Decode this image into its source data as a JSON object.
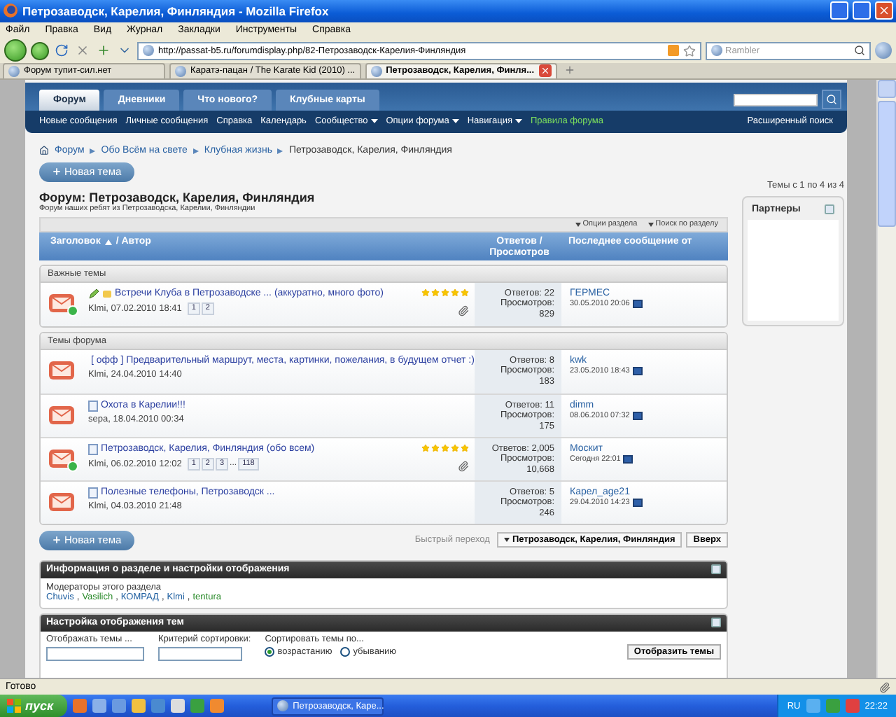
{
  "window": {
    "title": "Петрозаводск, Карелия, Финляндия - Mozilla Firefox"
  },
  "menu": [
    "Файл",
    "Правка",
    "Вид",
    "Журнал",
    "Закладки",
    "Инструменты",
    "Справка"
  ],
  "toolbar": {
    "url": "http://passat-b5.ru/forumdisplay.php/82-Петрозаводск-Карелия-Финляндия",
    "search_placeholder": "Rambler"
  },
  "tabs": [
    {
      "label": "Форум тупит-сил.нет",
      "selected": false
    },
    {
      "label": "Каратэ-пацан / The Karate Kid (2010) ...",
      "selected": false
    },
    {
      "label": "Петрозаводск, Карелия, Финля...",
      "selected": true
    }
  ],
  "forum_nav": {
    "tabs": [
      {
        "label": "Форум",
        "selected": true
      },
      {
        "label": "Дневники",
        "selected": false
      },
      {
        "label": "Что нового?",
        "selected": false
      },
      {
        "label": "Клубные карты",
        "selected": false
      }
    ],
    "links": [
      {
        "label": "Новые сообщения",
        "kind": "link"
      },
      {
        "label": "Личные сообщения",
        "kind": "link"
      },
      {
        "label": "Справка",
        "kind": "link"
      },
      {
        "label": "Календарь",
        "kind": "link"
      },
      {
        "label": "Сообщество",
        "kind": "dropdown"
      },
      {
        "label": "Опции форума",
        "kind": "dropdown"
      },
      {
        "label": "Навигация",
        "kind": "dropdown"
      },
      {
        "label": "Правила форума",
        "kind": "highlight"
      }
    ],
    "advanced_search": "Расширенный поиск"
  },
  "breadcrumb": [
    "Форум",
    "Обо Всём на свете",
    "Клубная жизнь",
    "Петрозаводск, Карелия, Финляндия"
  ],
  "new_topic_buttons": [
    "Новая тема",
    "Новая тема"
  ],
  "topic_count": "Темы с 1 по 4 из 4",
  "sidebar": {
    "title": "Партнеры"
  },
  "forum": {
    "title": "Форум: Петрозаводск, Карелия, Финляндия",
    "subtitle": "Форум наших ребят из Петрозаводска, Карелии, Финляндии"
  },
  "options": [
    "Опции раздела",
    "Поиск по разделу"
  ],
  "columns": {
    "title": "Заголовок",
    "author": "/ Автор",
    "stats": "Ответов / Просмотров",
    "last": "Последнее сообщение от"
  },
  "sections": [
    {
      "title": "Важные темы",
      "threads": [
        {
          "kind": "sticky",
          "badge": true,
          "title": "Встречи Клуба в Петрозаводске ... (аккуратно, много фото)",
          "author": "Klmi, 07.02.2010 18:41",
          "pages": [
            {
              "label": "1",
              "kind": "page"
            },
            {
              "label": "2",
              "kind": "page"
            }
          ],
          "stars": 5,
          "attachment": true,
          "replies": "Ответов: 22",
          "views_label": "Просмотров:",
          "views": "829",
          "last_user": "ГЕРМЕС",
          "last_date": "30.05.2010 20:06"
        }
      ]
    },
    {
      "title": "Темы форума",
      "threads": [
        {
          "kind": "normal",
          "badge": false,
          "title": "[ офф ] Предварительный маршрут, места, картинки, пожелания, в будущем отчет :)",
          "author": "Klmi, 24.04.2010 14:40",
          "attachment": false,
          "replies": "Ответов: 8",
          "views_label": "Просмотров:",
          "views": "183",
          "last_user": "kwk",
          "last_date": "23.05.2010 18:43"
        },
        {
          "kind": "normal",
          "badge": false,
          "title": "Охота в Карелии!!!",
          "author": "sepa, 18.04.2010 00:34",
          "attachment": false,
          "replies": "Ответов: 11",
          "views_label": "Просмотров:",
          "views": "175",
          "last_user": "dimm",
          "last_date": "08.06.2010 07:32"
        },
        {
          "kind": "normal",
          "badge": true,
          "title": "Петрозаводск, Карелия, Финляндия (обо всем)",
          "author": "Klmi, 06.02.2010 12:02",
          "pages": [
            {
              "label": "1",
              "kind": "page"
            },
            {
              "label": "2",
              "kind": "page"
            },
            {
              "label": "3",
              "kind": "page"
            },
            {
              "label": "...",
              "kind": "gap"
            },
            {
              "label": "118",
              "kind": "page"
            }
          ],
          "stars": 5,
          "attachment": true,
          "replies": "Ответов: 2,005",
          "views_label": "Просмотров:",
          "views": "10,668",
          "last_user": "Москит",
          "last_date": "Сегодня 22:01"
        },
        {
          "kind": "normal",
          "badge": false,
          "title": "Полезные телефоны, Петрозаводск ...",
          "author": "Klmi, 04.03.2010 21:48",
          "attachment": false,
          "replies": "Ответов: 5",
          "views_label": "Просмотров:",
          "views": "246",
          "last_user": "Карел_age21",
          "last_date": "29.04.2010 14:23"
        }
      ]
    }
  ],
  "quick_nav": {
    "label": "Быстрый переход",
    "select": "Петрозаводск, Карелия, Финляндия",
    "button": "Вверх"
  },
  "info_panel": {
    "title": "Информация о разделе и настройки отображения",
    "moderators_label": "Модераторы этого раздела",
    "separator": ",",
    "moderators": [
      {
        "name": "Chuvis",
        "color": "#1f5fa0"
      },
      {
        "name": "Vasilich",
        "color": "#2a8a2a"
      },
      {
        "name": "КОМРАД",
        "color": "#1f5fa0"
      },
      {
        "name": "Klmi",
        "color": "#1f5fa0"
      },
      {
        "name": "tentura",
        "color": "#2a8a2a"
      }
    ]
  },
  "display_panel": {
    "title": "Настройка отображения тем",
    "fields": [
      "Отображать темы ...",
      "Критерий сортировки:"
    ],
    "sort_label": "Сортировать темы по...",
    "radios": [
      {
        "label": "возрастанию",
        "selected": true
      },
      {
        "label": "убыванию",
        "selected": false
      }
    ],
    "button": "Отобразить темы"
  },
  "status": "Готово",
  "taskbar": {
    "start": "пуск",
    "task": "Петрозаводск, Каре...",
    "lang": "RU",
    "time": "22:22"
  }
}
